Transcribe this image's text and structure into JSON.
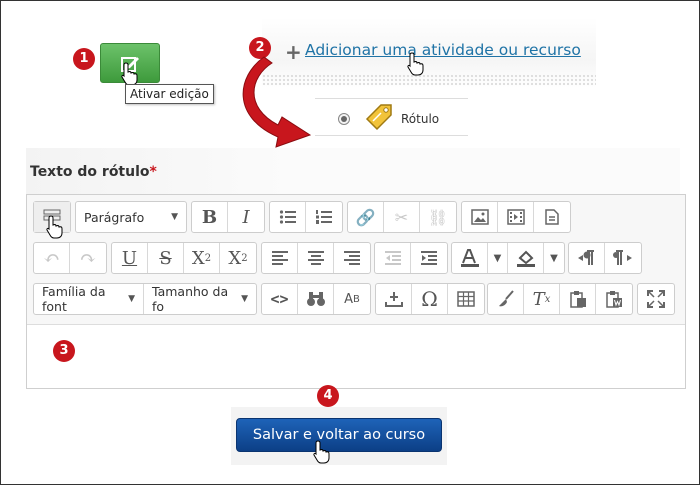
{
  "steps": [
    "1",
    "2",
    "3",
    "4"
  ],
  "edit_button": {
    "tooltip": "Ativar edição",
    "icon": "pencil-icon"
  },
  "add_activity": {
    "link": "Adicionar uma atividade ou recurso",
    "icon": "plus-icon"
  },
  "activity_option": {
    "label": "Rótulo",
    "icon": "tag-icon"
  },
  "editor": {
    "label": "Texto do rótulo",
    "required_mark": "*",
    "paragraph_select": "Parágrafo",
    "font_family_select": "Família da font",
    "font_size_select": "Tamanho da fo"
  },
  "save_button": "Salvar e voltar ao curso",
  "colors": {
    "step_badge": "#c8161d",
    "save_button": "#0c3f86",
    "edit_button": "#3e9a3c",
    "link": "#1f73a6"
  }
}
